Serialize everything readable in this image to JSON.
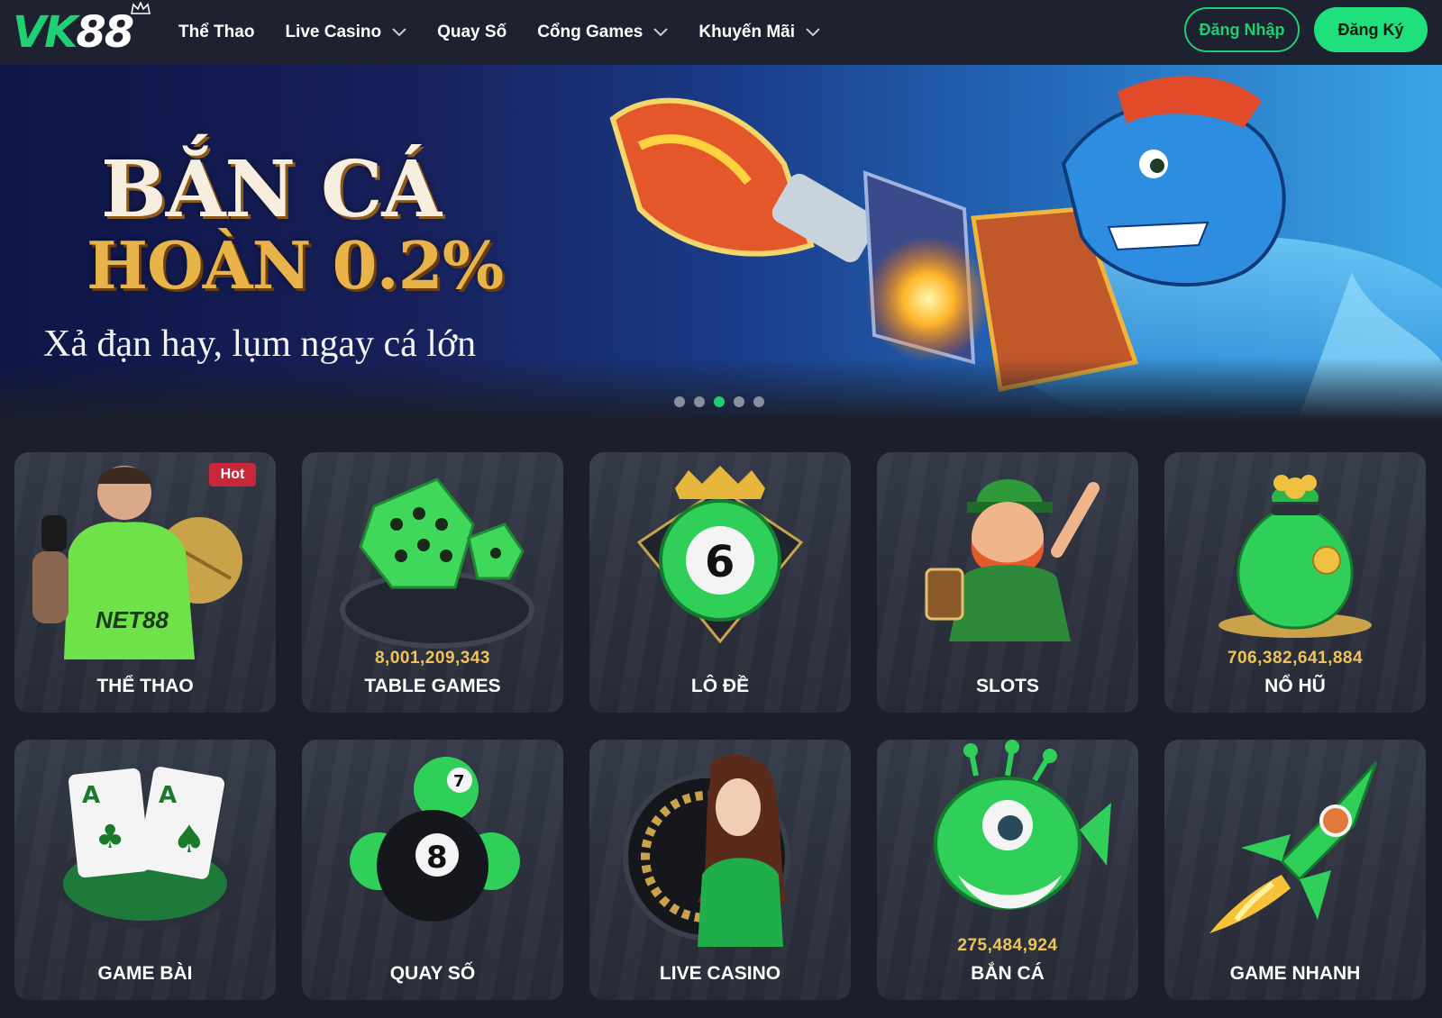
{
  "brand": {
    "logo_left": "VK",
    "logo_right": "88",
    "accent": "#1fcf73"
  },
  "nav": [
    {
      "label": "Thể Thao",
      "dropdown": false
    },
    {
      "label": "Live Casino",
      "dropdown": true
    },
    {
      "label": "Quay Số",
      "dropdown": false
    },
    {
      "label": "Cổng Games",
      "dropdown": true
    },
    {
      "label": "Khuyến Mãi",
      "dropdown": true
    }
  ],
  "auth": {
    "login": "Đăng Nhập",
    "register": "Đăng Ký"
  },
  "banner": {
    "title_line1": "BẮN CÁ",
    "title_line2": "HOÀN 0.2%",
    "subtitle": "Xả đạn hay, lụm ngay cá lớn",
    "slide_count": 5,
    "active_slide": 3
  },
  "cards": [
    {
      "label": "THỂ THAO",
      "amount": "",
      "badge": "Hot",
      "icon": "soccer-player-icon"
    },
    {
      "label": "TABLE GAMES",
      "amount": "8,001,209,343",
      "badge": "",
      "icon": "dice-icon"
    },
    {
      "label": "LÔ ĐỀ",
      "amount": "",
      "badge": "",
      "icon": "lottery-ball-icon"
    },
    {
      "label": "SLOTS",
      "amount": "",
      "badge": "",
      "icon": "leprechaun-icon"
    },
    {
      "label": "NỔ HŨ",
      "amount": "706,382,641,884",
      "badge": "",
      "icon": "money-bag-icon"
    },
    {
      "label": "GAME BÀI",
      "amount": "",
      "badge": "",
      "icon": "playing-cards-icon"
    },
    {
      "label": "QUAY SỐ",
      "amount": "",
      "badge": "",
      "icon": "billiard-balls-icon"
    },
    {
      "label": "LIVE CASINO",
      "amount": "",
      "badge": "",
      "icon": "live-dealer-icon"
    },
    {
      "label": "BẮN CÁ",
      "amount": "275,484,924",
      "badge": "",
      "icon": "fish-monster-icon"
    },
    {
      "label": "GAME NHANH",
      "amount": "",
      "badge": "",
      "icon": "rocket-icon"
    }
  ]
}
